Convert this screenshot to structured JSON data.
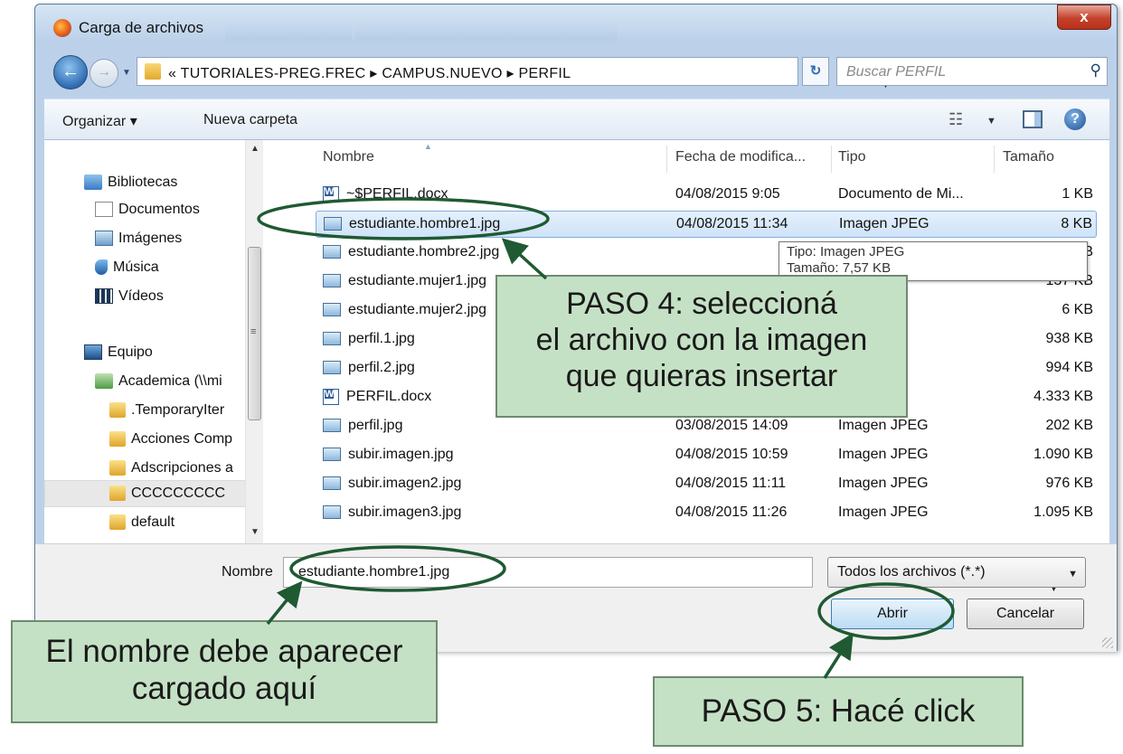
{
  "window": {
    "title": "Carga de archivos",
    "close_label": "x"
  },
  "address": {
    "path": "« TUTORIALES-PREG.FREC ▸ CAMPUS.NUEVO ▸ PERFIL",
    "search_placeholder": "Buscar PERFIL"
  },
  "toolbar": {
    "organize_label": "Organizar ▾",
    "new_folder_label": "Nueva carpeta"
  },
  "nav": {
    "items": [
      {
        "label": "Bibliotecas",
        "icon": "library-icon"
      },
      {
        "label": "Documentos",
        "icon": "documents-icon"
      },
      {
        "label": "Imágenes",
        "icon": "pictures-icon"
      },
      {
        "label": "Música",
        "icon": "music-icon"
      },
      {
        "label": "Vídeos",
        "icon": "videos-icon"
      },
      {
        "label": "Equipo",
        "icon": "computer-icon"
      },
      {
        "label": "Academica (\\\\mi",
        "icon": "network-drive-icon"
      },
      {
        "label": ".TemporaryIter",
        "icon": "folder-icon"
      },
      {
        "label": "Acciones Comp",
        "icon": "folder-icon"
      },
      {
        "label": "Adscripciones a",
        "icon": "folder-icon"
      },
      {
        "label": "CCCCCCCCC",
        "icon": "folder-icon"
      },
      {
        "label": "default",
        "icon": "folder-icon"
      }
    ]
  },
  "columns": {
    "name": "Nombre",
    "date": "Fecha de modifica...",
    "type": "Tipo",
    "size": "Tamaño"
  },
  "files": [
    {
      "name": "~$PERFIL.docx",
      "date": "04/08/2015 9:05",
      "type": "Documento de Mi...",
      "size": "1 KB",
      "kind": "doc"
    },
    {
      "name": "estudiante.hombre1.jpg",
      "date": "04/08/2015 11:34",
      "type": "Imagen JPEG",
      "size": "8 KB",
      "kind": "jpg"
    },
    {
      "name": "estudiante.hombre2.jpg",
      "date": "",
      "type": "JPEG",
      "size": "156 KB",
      "kind": "jpg"
    },
    {
      "name": "estudiante.mujer1.jpg",
      "date": "",
      "type": "",
      "size": "137 KB",
      "kind": "jpg"
    },
    {
      "name": "estudiante.mujer2.jpg",
      "date": "",
      "type": "",
      "size": "6 KB",
      "kind": "jpg"
    },
    {
      "name": "perfil.1.jpg",
      "date": "",
      "type": "",
      "size": "938 KB",
      "kind": "jpg"
    },
    {
      "name": "perfil.2.jpg",
      "date": "",
      "type": "",
      "size": "994 KB",
      "kind": "jpg"
    },
    {
      "name": "PERFIL.docx",
      "date": "",
      "type": "e Mi...",
      "size": "4.333 KB",
      "kind": "doc"
    },
    {
      "name": "perfil.jpg",
      "date": "03/08/2015 14:09",
      "type": "Imagen JPEG",
      "size": "202 KB",
      "kind": "jpg"
    },
    {
      "name": "subir.imagen.jpg",
      "date": "04/08/2015 10:59",
      "type": "Imagen JPEG",
      "size": "1.090 KB",
      "kind": "jpg"
    },
    {
      "name": "subir.imagen2.jpg",
      "date": "04/08/2015 11:11",
      "type": "Imagen JPEG",
      "size": "976 KB",
      "kind": "jpg"
    },
    {
      "name": "subir.imagen3.jpg",
      "date": "04/08/2015 11:26",
      "type": "Imagen JPEG",
      "size": "1.095 KB",
      "kind": "jpg"
    }
  ],
  "selected_file_index": 1,
  "tooltip": {
    "line1": "Tipo: Imagen JPEG",
    "line2": "Tamaño: 7,57 KB"
  },
  "footer": {
    "filename_label": "Nombre",
    "filename_value": "estudiante.hombre1.jpg",
    "filetype_value": "Todos los archivos (*.*)",
    "open_label": "Abrir",
    "cancel_label": "Cancelar"
  },
  "callouts": {
    "step4": [
      "PASO 4: seleccioná",
      "el archivo con la imagen",
      "que quieras insertar"
    ],
    "name_hint": [
      "El nombre debe aparecer",
      "cargado aquí"
    ],
    "step5": "PASO 5: Hacé click"
  },
  "colors": {
    "callout_fill": "#c5e1c5",
    "annotation_stroke": "#1f5a33",
    "selection_fill": "#cfe3f8"
  }
}
